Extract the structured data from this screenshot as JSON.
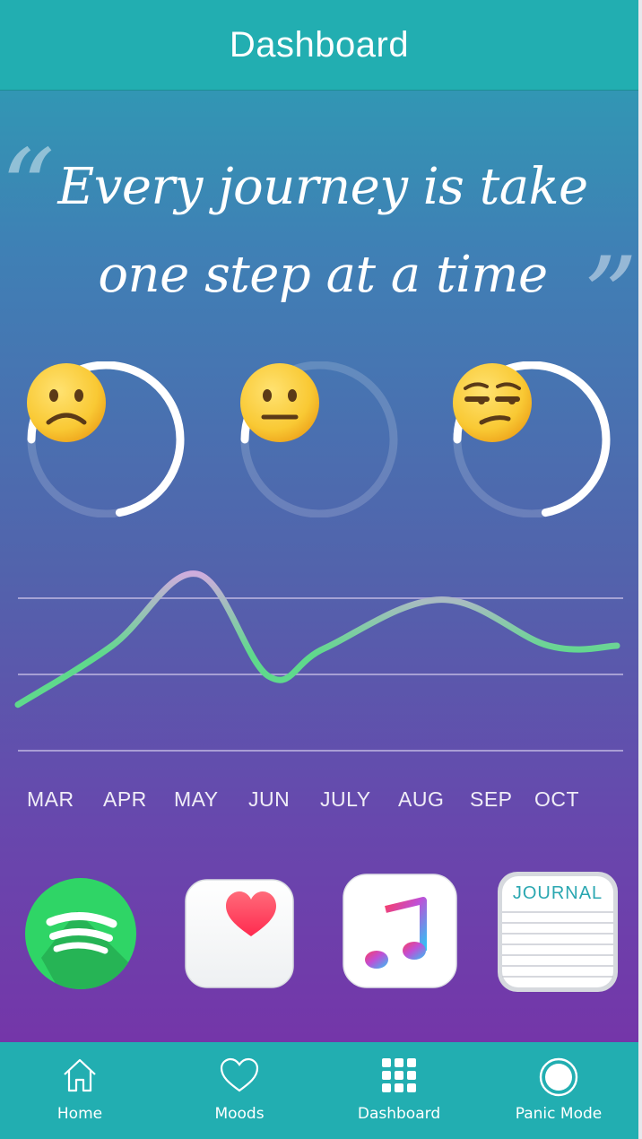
{
  "header": {
    "title": "Dashboard"
  },
  "quote": {
    "open_mark": "“",
    "line1": "Every journey is take",
    "line2": "one step at a time",
    "close_mark": "”"
  },
  "mood_rings": [
    {
      "icon": "frowning-face-emoji",
      "progress": 0.72
    },
    {
      "icon": "neutral-face-emoji",
      "progress": 0.12
    },
    {
      "icon": "unamused-face-emoji",
      "progress": 0.72
    }
  ],
  "chart_data": {
    "type": "line",
    "categories": [
      "MAR",
      "APR",
      "MAY",
      "JUN",
      "JULY",
      "AUG",
      "SEP",
      "OCT"
    ],
    "values": [
      2.2,
      4.5,
      7.3,
      3.3,
      4.4,
      6.3,
      4.5,
      4.5
    ],
    "ylim": [
      1,
      8
    ],
    "grid": true,
    "colors": {
      "line_low": "#5fd98c",
      "line_high": "#e6a3ee",
      "grid": "#c7bfe6"
    }
  },
  "apps": [
    {
      "name": "spotify",
      "color": "#2fd566"
    },
    {
      "name": "health",
      "color": "#ff3b54"
    },
    {
      "name": "music",
      "color": "#fa5a78"
    },
    {
      "name": "journal",
      "label": "JOURNAL"
    }
  ],
  "tabs": [
    {
      "icon": "home-icon",
      "label": "Home"
    },
    {
      "icon": "heart-icon",
      "label": "Moods"
    },
    {
      "icon": "grid-icon",
      "label": "Dashboard"
    },
    {
      "icon": "panic-circle-icon",
      "label": "Panic Mode"
    }
  ],
  "colors": {
    "accent": "#22aeb1",
    "gradient_top": "#2aa3b3",
    "gradient_bottom": "#7a2ea7"
  }
}
